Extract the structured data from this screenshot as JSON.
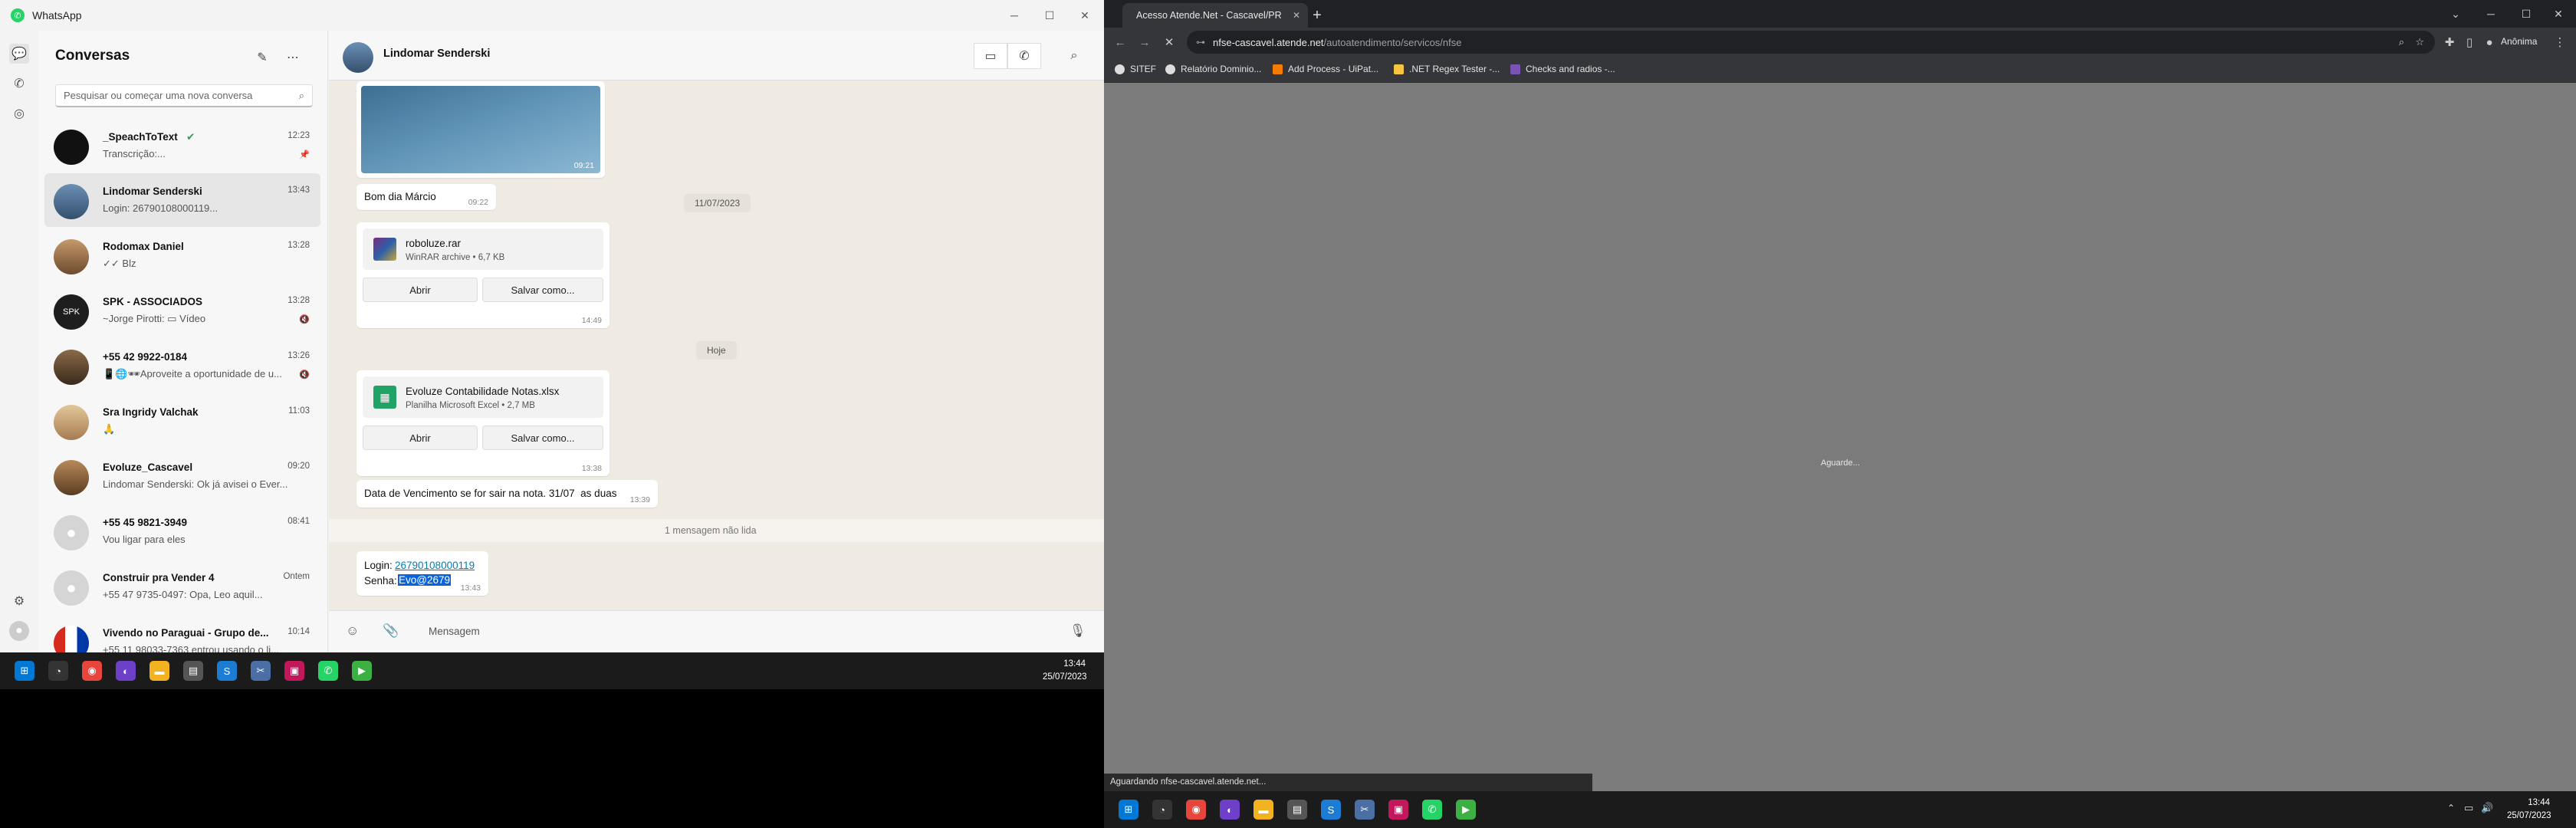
{
  "whatsapp": {
    "window_title": "WhatsApp",
    "sidebar_title": "Conversas",
    "search_placeholder": "Pesquisar ou começar uma nova conversa",
    "chats": [
      {
        "name": "_SpeachToText",
        "preview": "Transcrição:...",
        "time": "12:23",
        "badge": "pin-icon"
      },
      {
        "name": "Lindomar Senderski",
        "preview": "Login: 26790108000119...",
        "time": "13:43"
      },
      {
        "name": "Rodomax Daniel",
        "preview": "✓✓ Blz",
        "time": "13:28"
      },
      {
        "name": "SPK - ASSOCIADOS",
        "preview": "~Jorge Pirotti: ▭ Vídeo",
        "time": "13:28",
        "badge": "mute-icon"
      },
      {
        "name": "+55 42 9922-0184",
        "preview": "📱🌐🕶Aproveite a oportunidade de u...",
        "time": "13:26",
        "badge": "mute-icon"
      },
      {
        "name": "Sra Ingridy Valchak",
        "preview": "🙏",
        "time": "11:03"
      },
      {
        "name": "Evoluze_Cascavel",
        "preview": "Lindomar Senderski: Ok já avisei o Ever...",
        "time": "09:20"
      },
      {
        "name": "+55 45 9821-3949",
        "preview": "Vou ligar para eles",
        "time": "08:41"
      },
      {
        "name": "Construir pra Vender 4",
        "preview": "+55 47 9735-0497: Opa, Leo aquil...",
        "time": "Ontem"
      },
      {
        "name": "Vivendo no Paraguai - Grupo de...",
        "preview": "+55 11 98033-7363 entrou usando o li...",
        "time": "10:14"
      }
    ],
    "conversation": {
      "contact": "Lindomar Senderski",
      "image_time": "09:21",
      "msg_good_morning": "Bom dia Márcio",
      "msg_good_morning_time": "09:22",
      "date_1": "11/07/2023",
      "file_1": {
        "name": "roboluze.rar",
        "meta": "WinRAR archive • 6,7 KB",
        "open": "Abrir",
        "save": "Salvar como...",
        "time": "14:49"
      },
      "date_2": "Hoje",
      "file_2": {
        "name": "Evoluze Contabilidade Notas.xlsx",
        "meta": "Planilha Microsoft Excel • 2,7 MB",
        "open": "Abrir",
        "save": "Salvar como...",
        "time": "13:38"
      },
      "msg_due": "Data de Vencimento se for sair na nota. 31/07  as duas",
      "msg_due_time": "13:39",
      "unread_divider": "1 mensagem não lida",
      "login_label": "Login:",
      "login_value": "26790108000119",
      "password_label": "Senha:",
      "password_value": "Evo@2679",
      "login_time": "13:43",
      "compose_placeholder": "Mensagem"
    }
  },
  "taskbar_left": {
    "time": "13:44",
    "date": "25/07/2023"
  },
  "chrome": {
    "tab_title": "Acesso Atende.Net - Cascavel/PR",
    "url_host": "nfse-cascavel.atende.net",
    "url_path": "/autoatendimento/servicos/nfse",
    "profile": "Anônima",
    "bookmarks": [
      "SITEF",
      "Relatório Dominio...",
      "Add Process - UiPat...",
      ".NET Regex Tester -...",
      "Checks and radios -..."
    ],
    "page_text": "Aguarde...",
    "status_text": "Aguardando nfse-cascavel.atende.net..."
  },
  "taskbar_right": {
    "time": "13:44",
    "date": "25/07/2023"
  },
  "colors": {
    "whatsapp_green": "#25d366",
    "link_blue": "#027eb5",
    "selection": "#0a64d8",
    "chrome_dark": "#202124"
  }
}
